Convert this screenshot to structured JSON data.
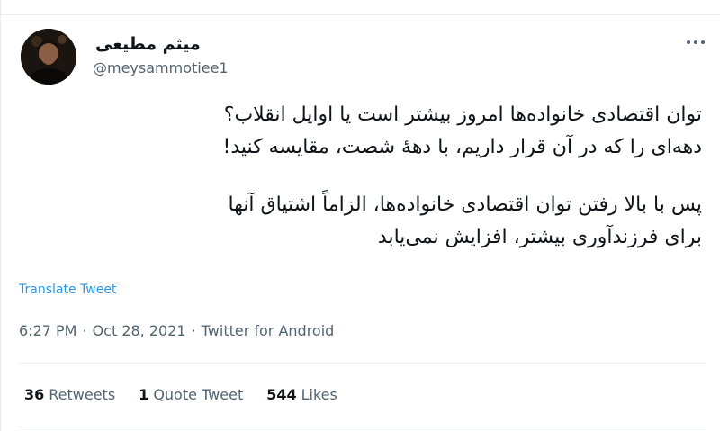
{
  "author": {
    "display_name": "میثم مطیعی",
    "handle": "@meysammotiee1"
  },
  "tweet": {
    "paragraph_1": "توان اقتصادی خانواده‌ها امروز بیشتر است یا اوایل انقلاب؟\nدهه‌ای را که در آن قرار داریم، با دههٔ شصت، مقایسه کنید!",
    "paragraph_2": "پس با بالا رفتن توان اقتصادی خانواده‌ها، الزاماً اشتیاق آنها\nبرای فرزندآوری بیشتر، افزایش نمی‌یابد"
  },
  "translate_label": "Translate Tweet",
  "meta": {
    "time": "6:27 PM",
    "separator_1": "·",
    "date": "Oct 28, 2021",
    "separator_2": "·",
    "source": "Twitter for Android"
  },
  "stats": {
    "retweets_count": "36",
    "retweets_label": "Retweets",
    "quotes_count": "1",
    "quotes_label": "Quote Tweet",
    "likes_count": "544",
    "likes_label": "Likes"
  },
  "icons": {
    "more": "more-horizontal-icon"
  },
  "colors": {
    "text": "#0f1419",
    "secondary": "#536471",
    "link": "#1d9bf0",
    "divider": "#e6ecf0"
  }
}
